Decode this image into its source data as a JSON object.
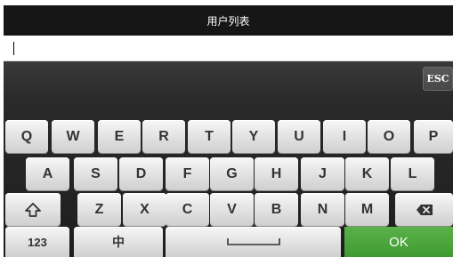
{
  "title": "用户列表",
  "input": {
    "value": ""
  },
  "candidate_bar": {
    "esc_label": "ESC"
  },
  "keyboard": {
    "row1": [
      "Q",
      "W",
      "E",
      "R",
      "T",
      "Y",
      "U",
      "I",
      "O",
      "P"
    ],
    "row2": [
      "A",
      "S",
      "D",
      "F",
      "G",
      "H",
      "J",
      "K",
      "L"
    ],
    "row3": [
      "Z",
      "X",
      "C",
      "V",
      "B",
      "N",
      "M"
    ],
    "row4": {
      "numbers_label": "123",
      "lang_label": "中",
      "ok_label": "OK"
    },
    "icons": {
      "shift": "shift-icon",
      "backspace": "backspace-icon",
      "space": "space-icon"
    }
  },
  "colors": {
    "title_bar": "#161616",
    "keyboard_bg": "#1e1e1e",
    "key_face": "#e6e6e6",
    "ok_green": "#4aa33b"
  }
}
